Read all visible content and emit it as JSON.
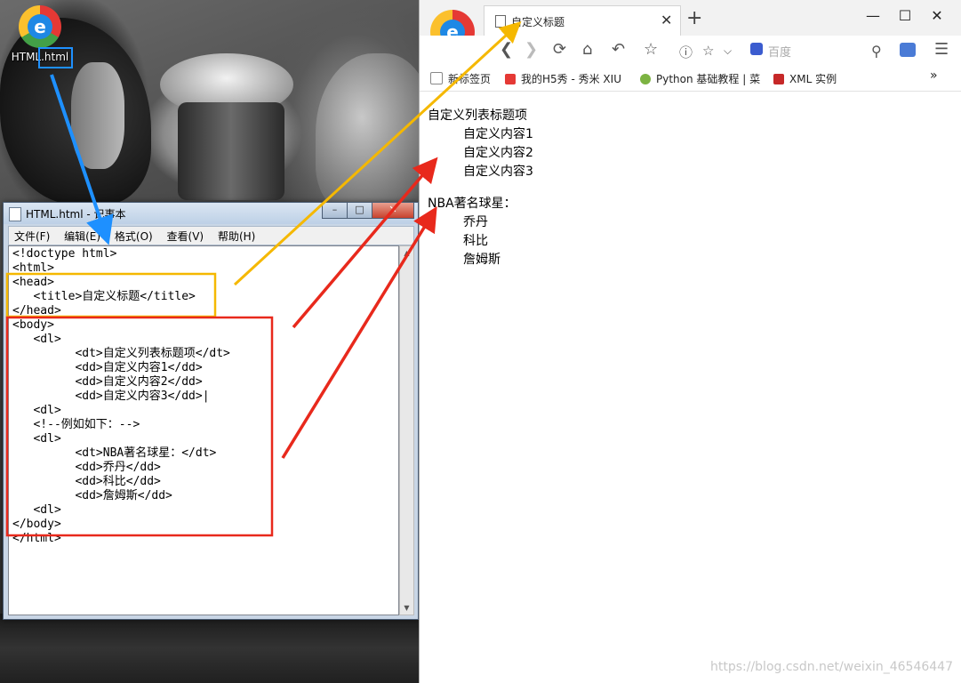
{
  "desktop": {
    "icon_label": "HTML.html",
    "icon_name": "edge-browser-icon"
  },
  "notepad": {
    "title": "HTML.html - 记事本",
    "menu": [
      "文件(F)",
      "编辑(E)",
      "格式(O)",
      "查看(V)",
      "帮助(H)"
    ],
    "code_lines": [
      "<!doctype html>",
      "<html>",
      "<head>",
      "   <title>自定义标题</title>",
      "</head>",
      "<body>",
      "   <dl>",
      "         <dt>自定义列表标题项</dt>",
      "         <dd>自定义内容1</dd>",
      "         <dd>自定义内容2</dd>",
      "         <dd>自定义内容3</dd>|",
      "   <dl>",
      "   <!--例如如下：-->",
      "   <dl>",
      "         <dt>NBA著名球星：</dt>",
      "         <dd>乔丹</dd>",
      "         <dd>科比</dd>",
      "         <dd>詹姆斯</dd>",
      "   <dl>",
      "</body>",
      "</html>"
    ]
  },
  "browser": {
    "tab_title": "自定义标题",
    "search_placeholder": "百度",
    "bookmarks": [
      {
        "label": "新标签页",
        "color": "#888888"
      },
      {
        "label": "我的H5秀 - 秀米 XIU",
        "color": "#e53935"
      },
      {
        "label": "Python 基础教程 | 菜",
        "color": "#7cb342"
      },
      {
        "label": "XML 实例",
        "color": "#c62828"
      }
    ],
    "page": {
      "lists": [
        {
          "dt": "自定义列表标题项",
          "dd": [
            "自定义内容1",
            "自定义内容2",
            "自定义内容3"
          ]
        },
        {
          "dt": "NBA著名球星：",
          "dd": [
            "乔丹",
            "科比",
            "詹姆斯"
          ]
        }
      ]
    },
    "watermark": "https://blog.csdn.net/weixin_46546447"
  },
  "colors": {
    "blue_annotation": "#1e90ff",
    "yellow_annotation": "#f5b800",
    "red_annotation": "#e8291c"
  }
}
